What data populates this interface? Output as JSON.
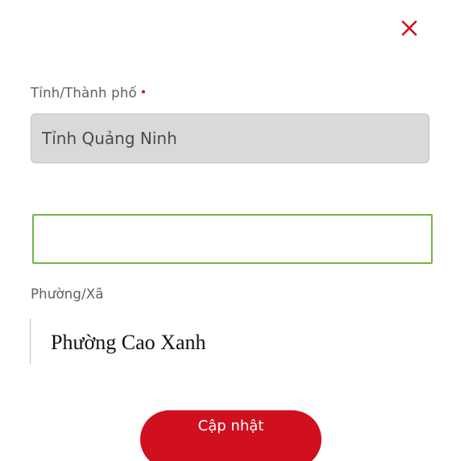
{
  "colors": {
    "accent": "#d0101f",
    "close_icon": "#d0101f",
    "required_marker": "#c8102e",
    "focus_border": "#73b544",
    "disabled_bg": "#d9d9d9"
  },
  "header": {
    "close_icon": "close-icon"
  },
  "form": {
    "province": {
      "label": "Tỉnh/Thành phố",
      "required": true,
      "value": "Tỉnh Quảng Ninh",
      "disabled": true
    },
    "district": {
      "value": "",
      "focused": true
    },
    "ward": {
      "label": "Phường/Xã",
      "value": "Phường Cao Xanh"
    }
  },
  "footer": {
    "submit_label": "Cập nhật"
  }
}
